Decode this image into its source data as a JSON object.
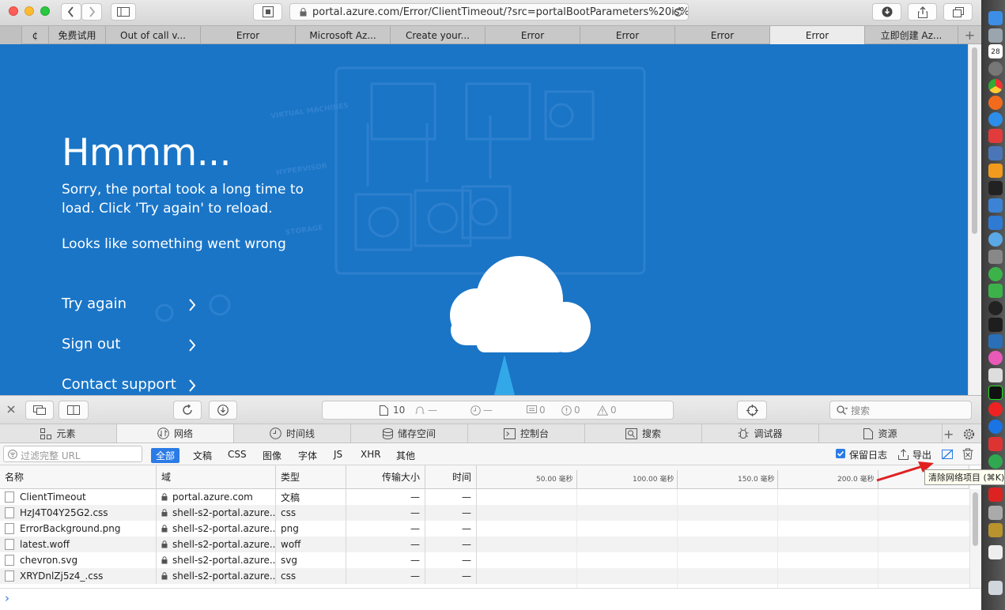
{
  "browser": {
    "url": "portal.azure.com/Error/ClientTimeout/?src=portalBootParameters%20is%20",
    "tabs": [
      {
        "label": "¢"
      },
      {
        "label": "免费试用"
      },
      {
        "label": "Out of call v..."
      },
      {
        "label": "Error"
      },
      {
        "label": "Microsoft Az..."
      },
      {
        "label": "Create your..."
      },
      {
        "label": "Error"
      },
      {
        "label": "Error"
      },
      {
        "label": "Error"
      },
      {
        "label": "Error"
      },
      {
        "label": "立即创建 Az..."
      }
    ],
    "new_tab": "+"
  },
  "page": {
    "heading": "Hmmm...",
    "line1": "Sorry, the portal took a long time to",
    "line2": "load. Click 'Try again' to reload.",
    "line3": "Looks like something went wrong",
    "links": [
      {
        "label": "Try again"
      },
      {
        "label": "Sign out"
      },
      {
        "label": "Contact support"
      }
    ],
    "bg_words": [
      "VIRTUAL MACHINES",
      "HYPERVISOR",
      "STORAGE"
    ]
  },
  "devtools": {
    "counts": {
      "resources": "10",
      "warn_bell": "—",
      "time": "—",
      "logs": "0",
      "errors": "0",
      "warnings": "0"
    },
    "search_placeholder": "搜索",
    "tabs": [
      "元素",
      "网络",
      "时间线",
      "储存空间",
      "控制台",
      "搜索",
      "调试器",
      "资源"
    ],
    "filter_placeholder": "过滤完整 URL",
    "filters": [
      "全部",
      "文稿",
      "CSS",
      "图像",
      "字体",
      "JS",
      "XHR",
      "其他"
    ],
    "preserve_log": "保留日志",
    "export": "导出",
    "columns": [
      "名称",
      "域",
      "类型",
      "传输大小",
      "时间"
    ],
    "timeline_ticks": [
      "50.00 毫秒",
      "100.00 毫秒",
      "150.0 毫秒",
      "200.0 毫秒"
    ],
    "rows": [
      {
        "name": "ClientTimeout",
        "domain": "portal.azure.com",
        "type": "文稿",
        "size": "—",
        "time": "—"
      },
      {
        "name": "HzJ4T04Y25G2.css",
        "domain": "shell-s2-portal.azure...",
        "type": "css",
        "size": "—",
        "time": "—"
      },
      {
        "name": "ErrorBackground.png",
        "domain": "shell-s2-portal.azure...",
        "type": "png",
        "size": "—",
        "time": "—"
      },
      {
        "name": "latest.woff",
        "domain": "shell-s2-portal.azure...",
        "type": "woff",
        "size": "—",
        "time": "—"
      },
      {
        "name": "chevron.svg",
        "domain": "shell-s2-portal.azure...",
        "type": "svg",
        "size": "—",
        "time": "—"
      },
      {
        "name": "XRYDnlZj5z4_.css",
        "domain": "shell-s2-portal.azure...",
        "type": "css",
        "size": "—",
        "time": "—"
      }
    ],
    "tooltip": "清除网络项目 (⌘K)",
    "console_prompt": "›"
  },
  "dock": {
    "calendar_day": "28"
  },
  "colors": {
    "azure_blue": "#1a75c7",
    "accent": "#2b7be6",
    "arrow_red": "#e02020"
  }
}
